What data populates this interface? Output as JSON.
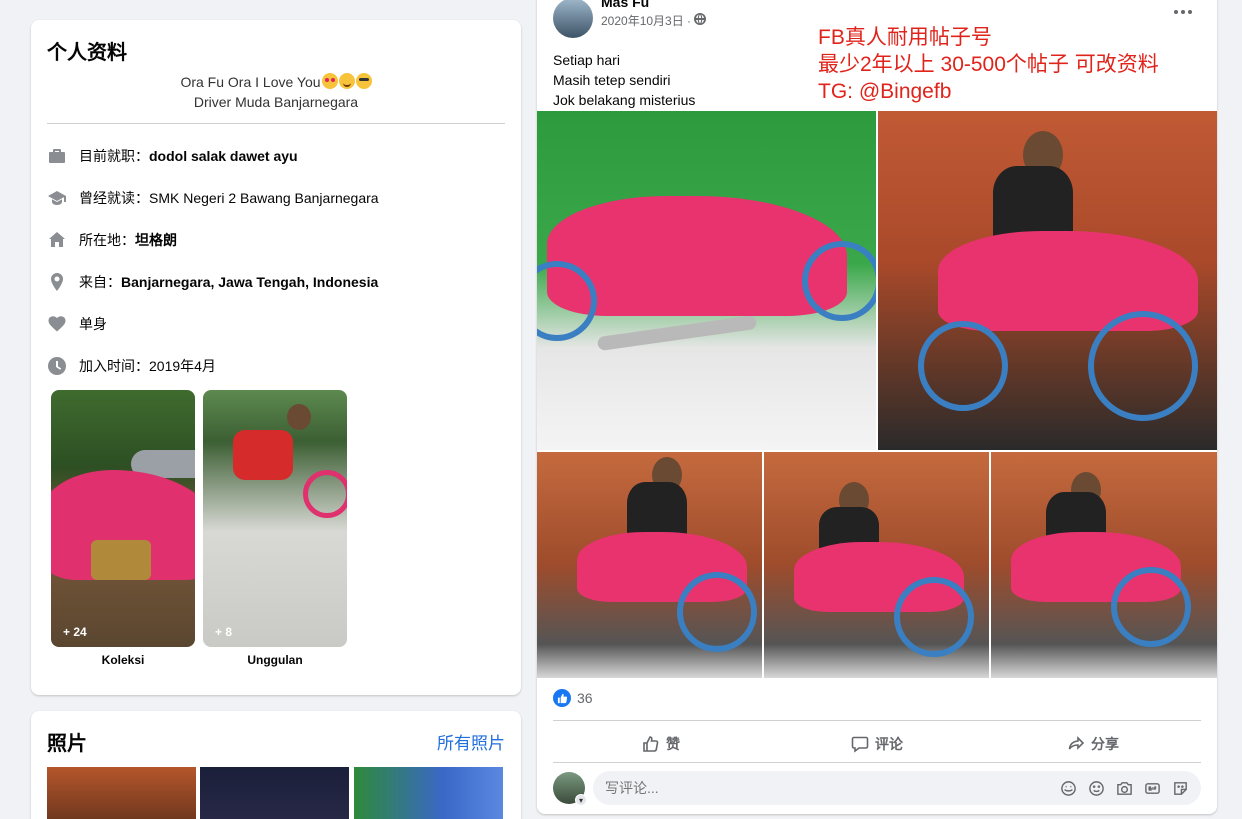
{
  "intro": {
    "title": "个人资料",
    "bio_line1": "Ora Fu Ora I Love You",
    "bio_line2": "Driver Muda Banjarnegara",
    "rows": [
      {
        "icon": "briefcase-icon",
        "label": "目前就职：",
        "value": "dodol salak dawet ayu"
      },
      {
        "icon": "graduation-cap-icon",
        "label": "曾经就读：",
        "value": "SMK Negeri 2 Bawang Banjarnegara"
      },
      {
        "icon": "home-icon",
        "label": "所在地：",
        "value": "坦格朗"
      },
      {
        "icon": "location-pin-icon",
        "label": "来自：",
        "value": "Banjarnegara, Jawa Tengah, Indonesia"
      },
      {
        "icon": "heart-icon",
        "label": "单身",
        "value": ""
      },
      {
        "icon": "clock-icon",
        "label": "加入时间：",
        "value": "2019年4月"
      }
    ],
    "collections": [
      {
        "count": "+ 24",
        "label": "Koleksi"
      },
      {
        "count": "+ 8",
        "label": "Unggulan"
      }
    ]
  },
  "photos": {
    "title": "照片",
    "all_link": "所有照片"
  },
  "post": {
    "author": "Mas Fu",
    "date": "2020年10月3日 ·",
    "privacy_icon": "globe-icon",
    "text_lines": [
      "Setiap hari",
      "Masih tetep sendiri",
      "Jok belakang misterius"
    ],
    "overlay_lines": [
      "FB真人耐用帖子号",
      "最少2年以上 30-500个帖子 可改资料",
      "TG: @Bingefb"
    ],
    "reaction_count": "36",
    "actions": {
      "like": "赞",
      "comment": "评论",
      "share": "分享"
    },
    "comment_placeholder": "写评论..."
  },
  "colors": {
    "accent": "#216fdb",
    "like_blue": "#1877f2",
    "overlay_red": "#e0241b"
  }
}
